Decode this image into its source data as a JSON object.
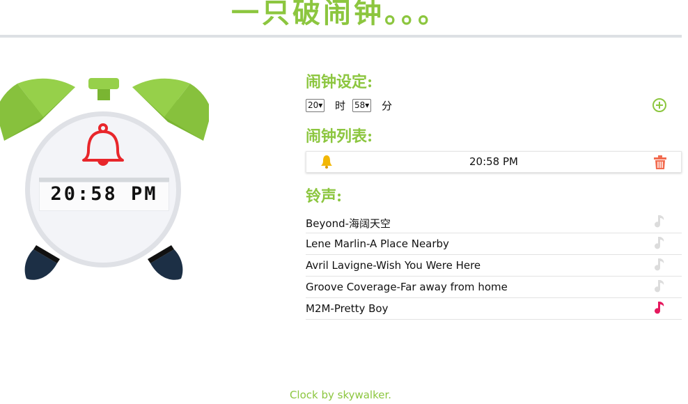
{
  "header": {
    "title": "一只破闹钟。。。"
  },
  "clock": {
    "display_time": "20:58 PM"
  },
  "alarm_settings": {
    "title": "闹钟设定:",
    "hour_value": "20",
    "hour_unit": "时",
    "minute_value": "58",
    "minute_unit": "分",
    "add_icon": "plus-circle-icon"
  },
  "alarm_list": {
    "title": "闹钟列表:",
    "items": [
      {
        "time": "20:58 PM",
        "icon": "bell-icon",
        "delete_icon": "trash-icon"
      }
    ]
  },
  "ringtones": {
    "title": "铃声:",
    "items": [
      {
        "name": "Beyond-海阔天空",
        "selected": false
      },
      {
        "name": "Lene Marlin-A Place Nearby",
        "selected": false
      },
      {
        "name": "Avril Lavigne-Wish You Were Here",
        "selected": false
      },
      {
        "name": "Groove Coverage-Far away from home",
        "selected": false
      },
      {
        "name": "M2M-Pretty Boy",
        "selected": true
      }
    ]
  },
  "footer": {
    "text": "Clock by skywalker."
  },
  "colors": {
    "accent": "#8cc63f",
    "bell_red": "#e8262b",
    "note_active": "#e5195e",
    "note_inactive": "#dcdcdc",
    "trash": "#f26b4f",
    "feet": "#1c2f45"
  }
}
